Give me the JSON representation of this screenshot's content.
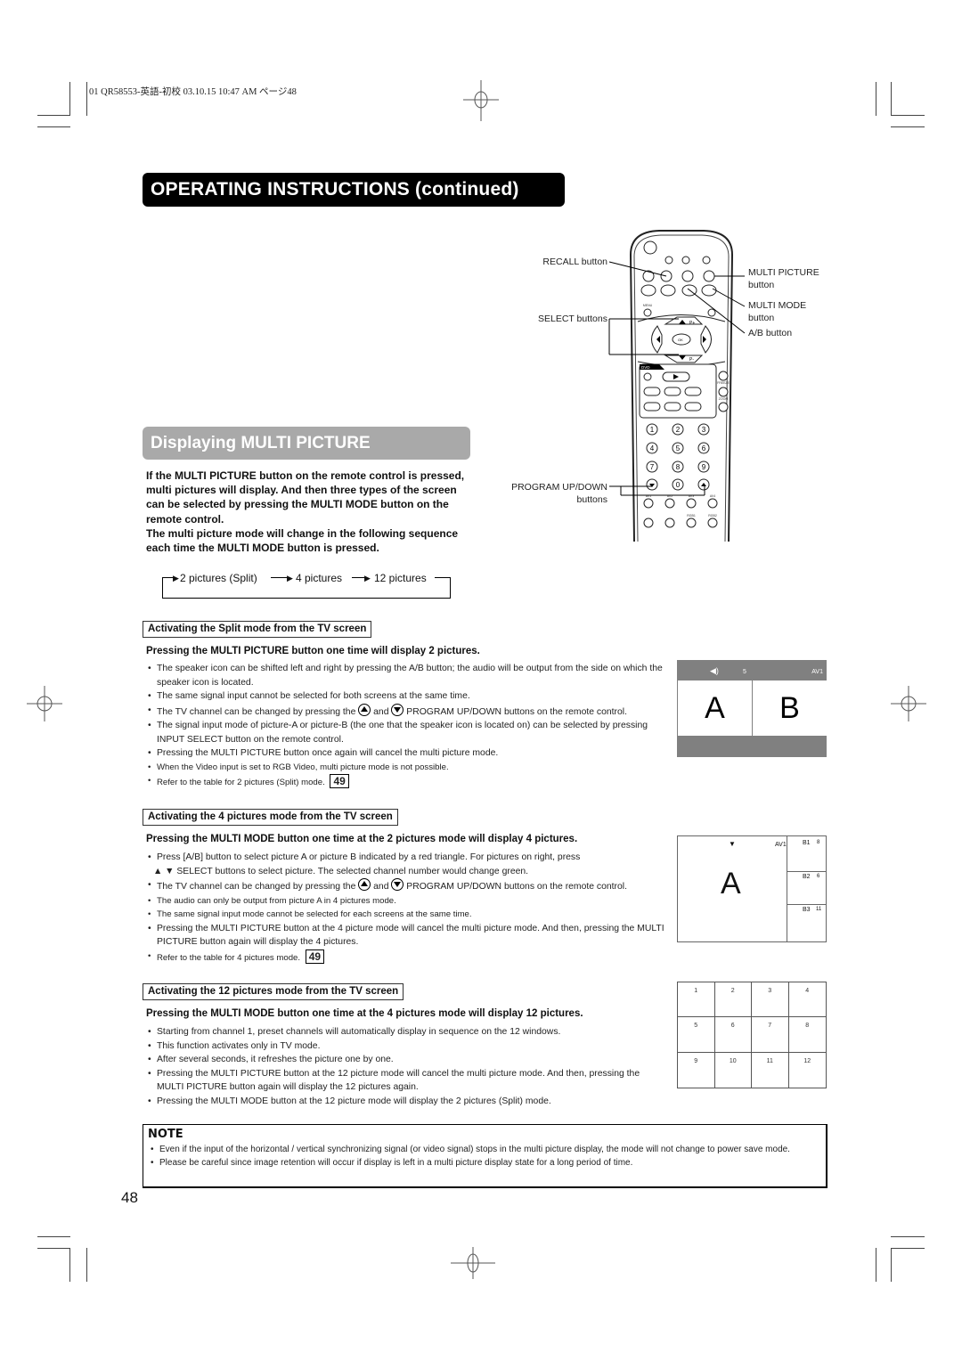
{
  "header_meta": "01 QR58553-英語-初校  03.10.15  10:47 AM  ページ48",
  "title": "OPERATING INSTRUCTIONS (continued)",
  "section_title": "Displaying MULTI PICTURE",
  "intro": "If the MULTI PICTURE button on the remote control is pressed, multi pictures will display. And then three types of the screen can be selected by pressing the MULTI MODE button on the remote control.",
  "intro2": "The multi picture mode will change in the following sequence each time the MULTI MODE button is pressed.",
  "sequence": [
    "2 pictures (Split)",
    "4 pictures",
    "12 pictures"
  ],
  "remote": {
    "callouts": {
      "recall": "RECALL button",
      "select": "SELECT buttons",
      "program": "PROGRAM UP/DOWN",
      "program2": "buttons",
      "multi_picture": "MULTI PICTURE",
      "multi_picture2": "button",
      "multi_mode": "MULTI MODE",
      "multi_mode2": "button",
      "ab": "A/B button"
    },
    "labels": {
      "dvd": "DVD",
      "menu": "MENU",
      "ok": "OK",
      "freeze": "FREEZE",
      "zoom": "ZOOM",
      "p_plus": "P+",
      "p_minus": "P-",
      "av1": "AV1",
      "av2": "AV2",
      "av3": "AV3",
      "av4": "AV4",
      "rgb1": "RGB1",
      "rgb2": "RGB2"
    },
    "digits": [
      "1",
      "2",
      "3",
      "4",
      "5",
      "6",
      "7",
      "8",
      "9",
      "0"
    ]
  },
  "split": {
    "heading": "Activating the Split mode from the TV screen",
    "bold": "Pressing the MULTI PICTURE button one time will display 2 pictures.",
    "bullets": [
      "The speaker icon can be shifted left and right by pressing the A/B button; the audio will be output from the side on which the speaker icon is located.",
      "The same signal input cannot be selected for both screens at the same time.",
      "The signal input mode of picture-A or picture-B (the one that the speaker icon is located on) can be selected by pressing INPUT SELECT button on the remote control.",
      "Pressing the MULTI PICTURE button once again will cancel the multi picture mode.",
      "When the Video input is set to RGB Video, multi picture mode is not possible.",
      "Refer to the table for 2 pictures (Split) mode."
    ],
    "tv_bullet_pre": "The TV channel can be changed by pressing the",
    "tv_bullet_and": "and",
    "tv_bullet_post": "PROGRAM UP/DOWN buttons on the remote control.",
    "page_ref": "49",
    "screen": {
      "channel": "5",
      "input": "AV1",
      "left": "A",
      "right": "B"
    }
  },
  "four": {
    "heading": "Activating the 4 pictures mode from the TV screen",
    "bold": "Pressing the MULTI MODE button one time at the 2 pictures mode will display 4 pictures.",
    "bullet1": "Press [A/B] button to select  picture A or picture B  indicated by a red triangle. For pictures on right, press",
    "bullet1b": "▲ ▼ SELECT buttons to select picture. The selected channel number would change green.",
    "tv_bullet_pre": "The TV channel can be changed by pressing the",
    "tv_bullet_and": "and",
    "tv_bullet_post": "PROGRAM UP/DOWN buttons on the remote control.",
    "bullets": [
      "The audio can only be output from picture A in 4 pictures mode.",
      "The same signal input mode cannot be selected for each screens at the same time.",
      "Pressing the MULTI PICTURE button at the 4 picture mode will cancel the multi picture mode. And then, pressing the MULTI PICTURE button again will display the 4 pictures.",
      "Refer to the table for 4 pictures mode."
    ],
    "page_ref": "49",
    "screen": {
      "main": "A",
      "input": "AV1",
      "subs": [
        {
          "label": "B1",
          "channel": "8"
        },
        {
          "label": "B2",
          "channel": "6"
        },
        {
          "label": "B3",
          "channel": "11"
        }
      ]
    }
  },
  "twelve": {
    "heading": "Activating the 12 pictures mode from the TV screen",
    "bold": "Pressing the MULTI MODE button one time at the 4 pictures mode will display 12 pictures.",
    "bullets": [
      "Starting from channel 1, preset channels will automatically display in sequence on the 12 windows.",
      "This function activates only in TV mode.",
      "After several seconds, it refreshes the picture one by one.",
      "Pressing the MULTI PICTURE button at the 12 picture mode will cancel the multi picture mode. And then, pressing the MULTI PICTURE button again will display the 12 pictures again.",
      "Pressing the MULTI MODE button at the 12 picture mode will display the 2 pictures (Split) mode."
    ],
    "screen_cells": [
      "1",
      "2",
      "3",
      "4",
      "5",
      "6",
      "7",
      "8",
      "9",
      "10",
      "11",
      "12"
    ]
  },
  "note": {
    "title": "NOTE",
    "bullets": [
      "Even if the input of the horizontal / vertical synchronizing signal (or video signal) stops in the multi picture display, the mode will not change to power save mode.",
      "Please be careful since image retention will occur if display is left in a multi picture display state for a long period of time."
    ]
  },
  "page_number": "48"
}
